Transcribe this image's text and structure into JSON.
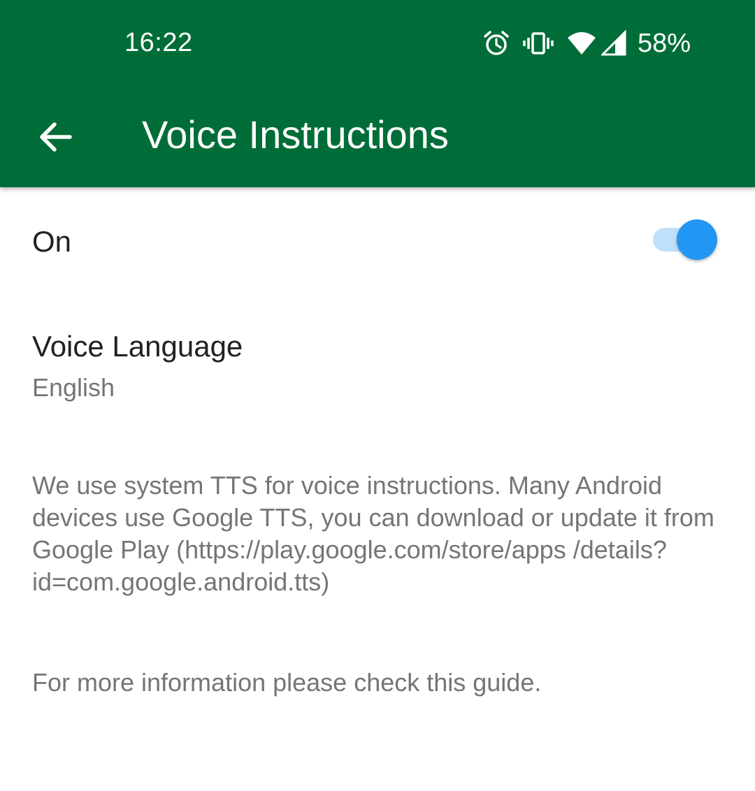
{
  "status_bar": {
    "time": "16:22",
    "icons": [
      "alarm-icon",
      "vibrate-icon",
      "wifi-icon",
      "cell-signal-icon"
    ],
    "battery": "58%"
  },
  "app_bar": {
    "back_icon": "arrow-left-icon",
    "title": "Voice Instructions",
    "color": "#006d38"
  },
  "settings": {
    "on_label": "On",
    "on_enabled": true,
    "switch_color": "#2196f3",
    "language_title": "Voice Language",
    "language_value": "English"
  },
  "info": {
    "tts_text": "We use system TTS for voice instructions. Many Android devices use Google TTS, you can download or update it from Google Play (https://play.google.com/store/apps /details?id=com.google.android.tts)",
    "guide_text": "For more information please check this guide."
  }
}
